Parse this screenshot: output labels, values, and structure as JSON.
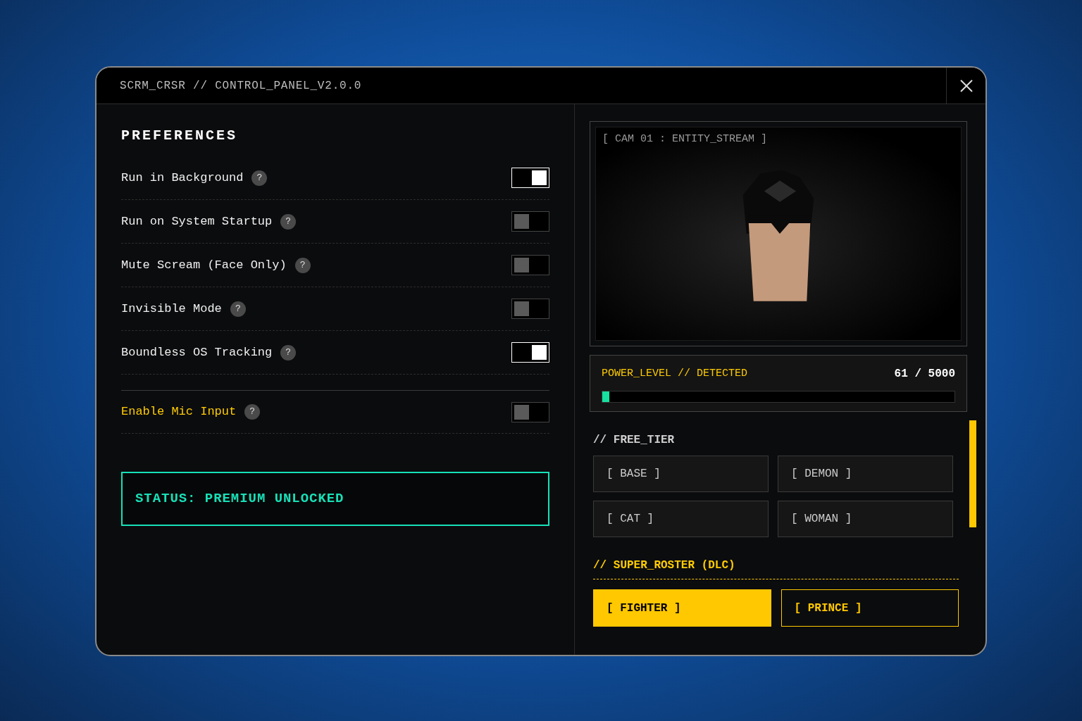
{
  "window": {
    "title": "SCRM_CRSR // CONTROL_PANEL_V2.0.0"
  },
  "preferences": {
    "heading": "PREFERENCES",
    "settings": [
      {
        "label": "Run in Background",
        "help": "?",
        "kind": "general",
        "on": true
      },
      {
        "label": "Run on System Startup",
        "help": "?",
        "kind": "general",
        "on": false
      },
      {
        "label": "Mute Scream (Face Only)",
        "help": "?",
        "kind": "general",
        "on": false
      },
      {
        "label": "Invisible Mode",
        "help": "?",
        "kind": "general",
        "on": false
      },
      {
        "label": "Boundless OS Tracking",
        "help": "?",
        "kind": "general",
        "on": true
      },
      {
        "label": "Enable Mic Input",
        "help": "?",
        "kind": "input",
        "on": false
      }
    ],
    "status": "STATUS: PREMIUM UNLOCKED"
  },
  "camera": {
    "label": "[ CAM 01 : ENTITY_STREAM ]"
  },
  "power": {
    "label": "POWER_LEVEL // DETECTED",
    "reading": "61 / 5000",
    "level": 0.02
  },
  "free_tier": {
    "heading": "// FREE_TIER",
    "items": [
      {
        "label": "[ BASE ]",
        "selected": false
      },
      {
        "label": "[ DEMON ]",
        "selected": false
      },
      {
        "label": "[ CAT ]",
        "selected": false
      },
      {
        "label": "[ WOMAN ]",
        "selected": false
      }
    ]
  },
  "super_roster": {
    "heading": "// SUPER_ROSTER (DLC)",
    "items": [
      {
        "label": "[ FIGHTER ]",
        "selected": true
      },
      {
        "label": "[ PRINCE ]",
        "selected": false
      }
    ]
  }
}
